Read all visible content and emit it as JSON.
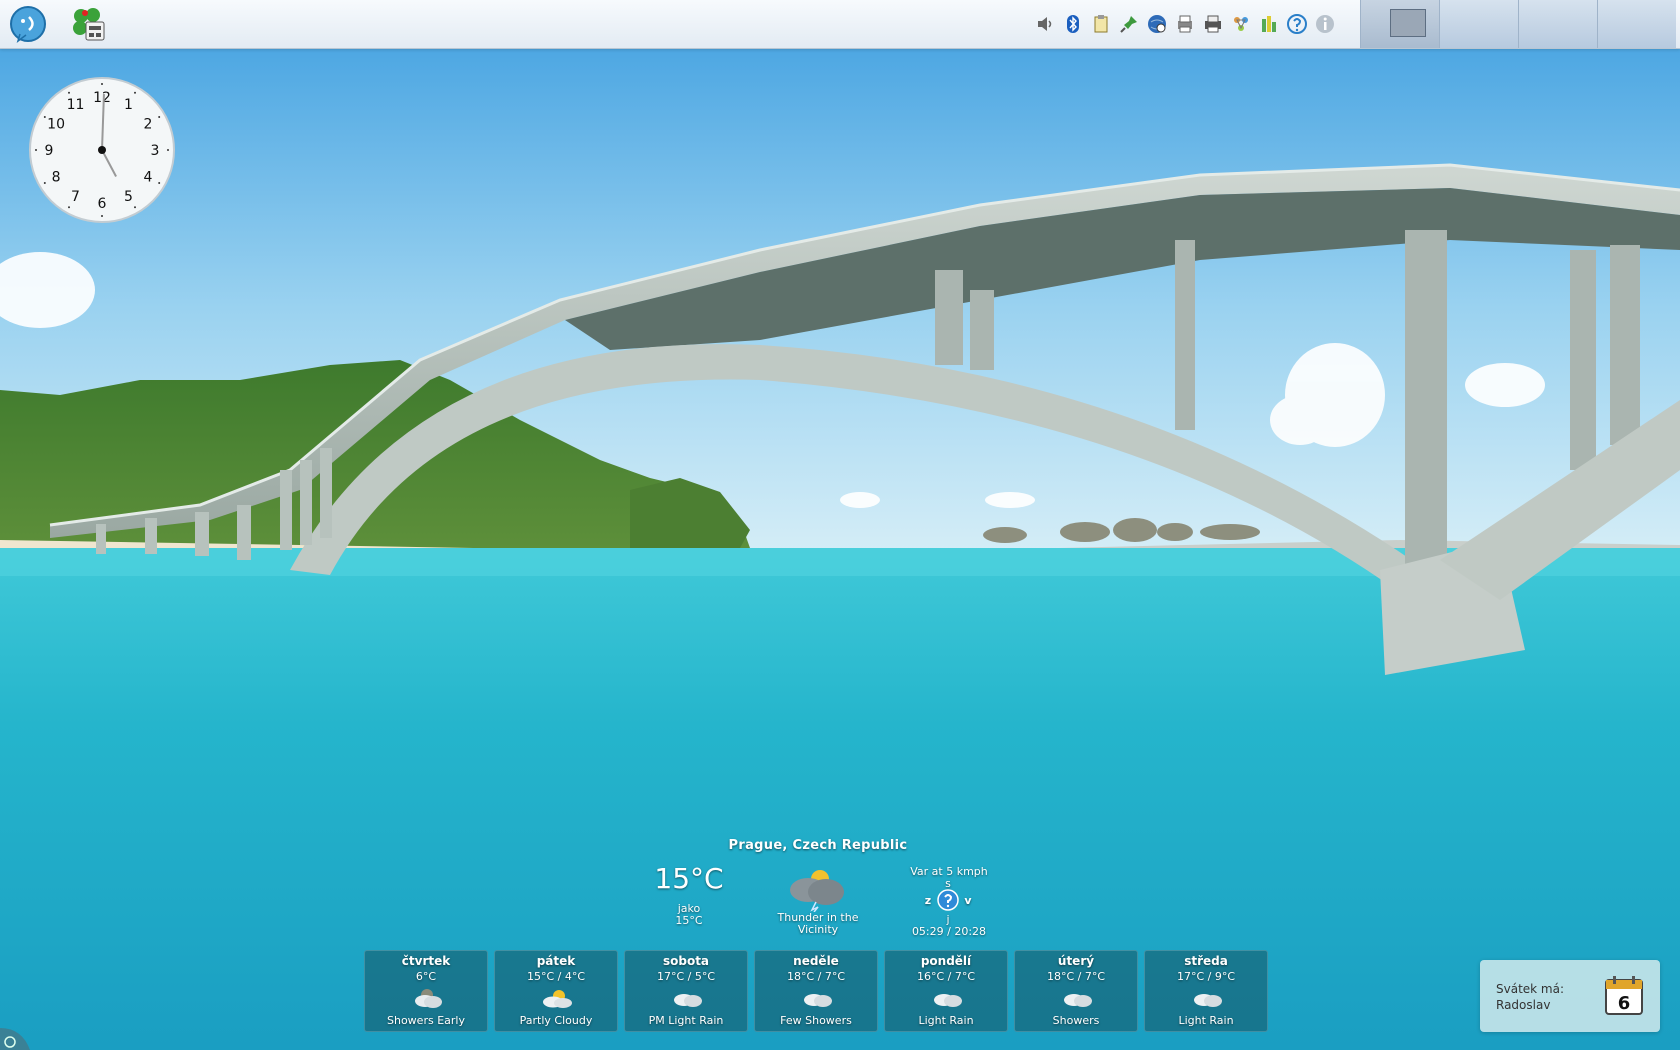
{
  "panel": {
    "launchers": [
      {
        "name": "kde-menu-icon"
      },
      {
        "name": "clover-app-icon"
      }
    ],
    "tray_icons": [
      "volume-icon",
      "bluetooth-icon",
      "clipboard-icon",
      "pin-icon",
      "network-globe-icon",
      "printer-queue-icon",
      "printer-icon",
      "kde-connect-icon",
      "battery-monitor-icon",
      "help-icon",
      "info-icon"
    ],
    "desktops": 4,
    "active_desktop": 1
  },
  "clock": {
    "numerals": [
      "12",
      "1",
      "2",
      "3",
      "4",
      "5",
      "6",
      "7",
      "8",
      "9",
      "10",
      "11"
    ],
    "hour_hand_deg": 152,
    "minute_hand_deg": 2
  },
  "weather": {
    "location": "Prague, Czech Republic",
    "temperature": "15°C",
    "feels_label": "jako",
    "feels_value": "15°C",
    "condition": "Thunder in the Vicinity",
    "wind": "Var at 5 kmph",
    "wind_dir_n": "s",
    "wind_dir_w": "z",
    "wind_dir_e": "v",
    "wind_dir_s": "j",
    "sun_times": "05:29 / 20:28",
    "forecast": [
      {
        "day": "čtvrtek",
        "temp": "6°C",
        "cond": "Showers Early",
        "icon": "night-cloud-icon"
      },
      {
        "day": "pátek",
        "temp": "15°C / 4°C",
        "cond": "Partly Cloudy",
        "icon": "partly-cloudy-icon"
      },
      {
        "day": "sobota",
        "temp": "17°C / 5°C",
        "cond": "PM Light Rain",
        "icon": "cloud-icon"
      },
      {
        "day": "neděle",
        "temp": "18°C / 7°C",
        "cond": "Few Showers",
        "icon": "cloud-icon"
      },
      {
        "day": "pondělí",
        "temp": "16°C / 7°C",
        "cond": "Light Rain",
        "icon": "cloud-icon"
      },
      {
        "day": "úterý",
        "temp": "18°C / 7°C",
        "cond": "Showers",
        "icon": "cloud-icon"
      },
      {
        "day": "středa",
        "temp": "17°C / 9°C",
        "cond": "Light Rain",
        "icon": "cloud-icon"
      }
    ]
  },
  "nameday": {
    "label": "Svátek má:",
    "name": "Radoslav",
    "date": "6"
  }
}
